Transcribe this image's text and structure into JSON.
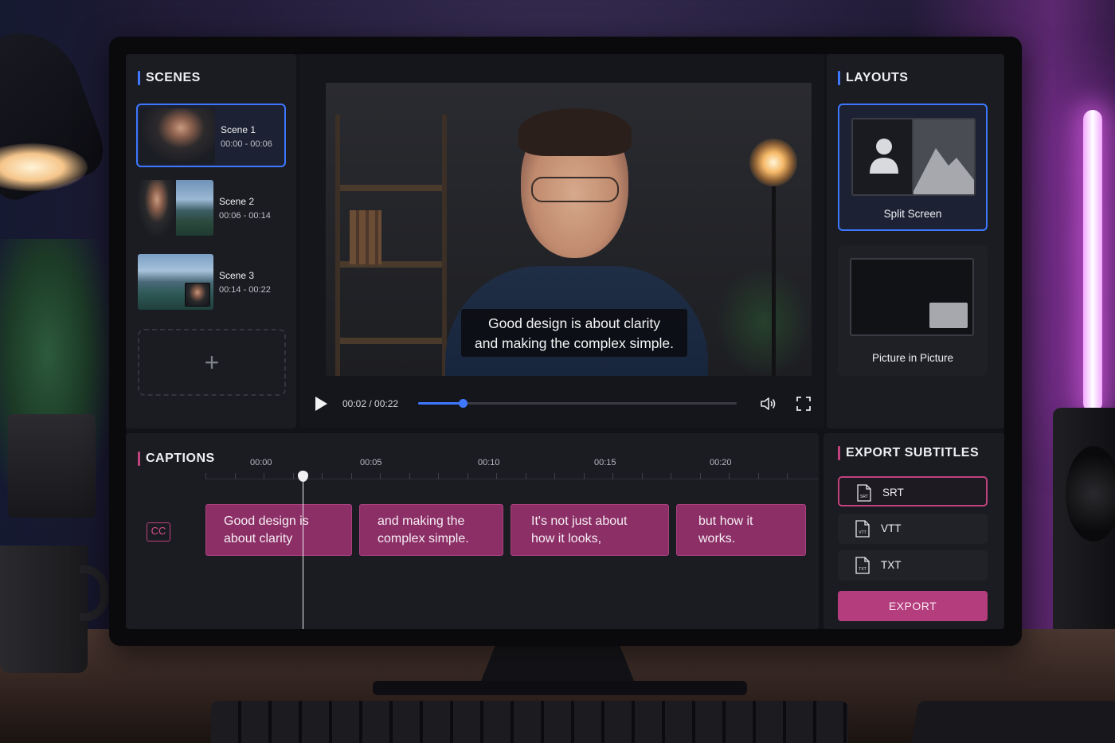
{
  "scenes": {
    "title": "SCENES",
    "items": [
      {
        "name": "Scene 1",
        "time": "00:00 - 00:06"
      },
      {
        "name": "Scene 2",
        "time": "00:06 - 00:14"
      },
      {
        "name": "Scene 3",
        "time": "00:14 - 00:22"
      }
    ],
    "add_icon": "+"
  },
  "player": {
    "caption_line1": "Good design is about clarity",
    "caption_line2": "and making the complex simple.",
    "time_display": "00:02 / 00:22",
    "progress": 0.14,
    "icons": [
      "play-icon",
      "volume-icon",
      "fullscreen-icon"
    ]
  },
  "layouts": {
    "title": "LAYOUTS",
    "items": [
      {
        "label": "Split Screen"
      },
      {
        "label": "Picture in Picture"
      }
    ]
  },
  "captions": {
    "title": "CAPTIONS",
    "cc_label": "CC",
    "timeline_marks": [
      "00:00",
      "00:05",
      "00:10",
      "00:15",
      "00:20"
    ],
    "blocks": [
      {
        "line1": "Good design is",
        "line2": "about clarity"
      },
      {
        "line1": "and making the",
        "line2": "complex simple."
      },
      {
        "line1": "It's not just about",
        "line2": "how it looks,"
      },
      {
        "line1": "but how it",
        "line2": "works."
      }
    ]
  },
  "export": {
    "title": "EXPORT SUBTITLES",
    "formats": [
      {
        "label": "SRT",
        "icon_text": "SRT"
      },
      {
        "label": "VTT",
        "icon_text": "VTT"
      },
      {
        "label": "TXT",
        "icon_text": "TXT"
      }
    ],
    "button_label": "EXPORT"
  },
  "colors": {
    "accent_blue": "#3d78ff",
    "accent_pink": "#b33d7d"
  }
}
